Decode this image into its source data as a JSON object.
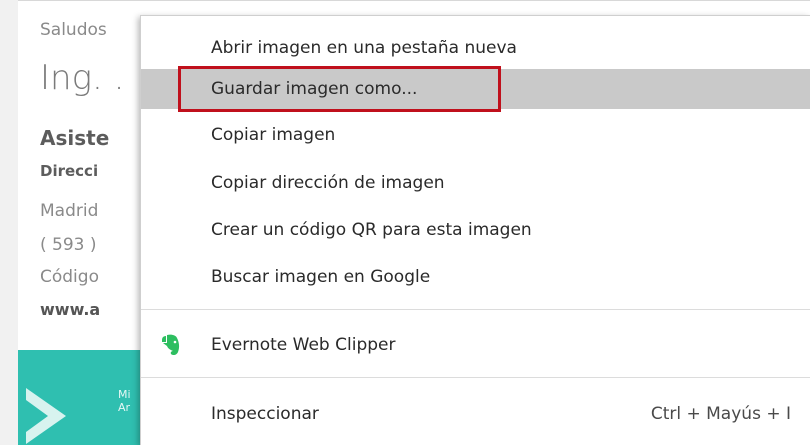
{
  "background_page": {
    "greeting": "Saludos",
    "name": "Ing. .",
    "role": "Asiste",
    "department": "Direcci",
    "city": "Madrid",
    "phone": "( 593 )",
    "code": "Código",
    "website": "www.a",
    "banner_text_line1": "Mi",
    "banner_text_line2": "Ar"
  },
  "context_menu": {
    "items": [
      {
        "label": "Abrir imagen en una pestaña nueva"
      },
      {
        "label": "Guardar imagen como..."
      },
      {
        "label": "Copiar imagen"
      },
      {
        "label": "Copiar dirección de imagen"
      },
      {
        "label": "Crear un código QR para esta imagen"
      },
      {
        "label": "Buscar imagen en Google"
      },
      {
        "label": "Evernote Web Clipper",
        "icon": "evernote-icon"
      },
      {
        "label": "Inspeccionar",
        "shortcut": "Ctrl + Mayús + I"
      }
    ],
    "highlighted_item": "Guardar imagen como...",
    "annotation_color": "#c0101c"
  },
  "colors": {
    "highlight": "#c9c9c9",
    "banner": "#2fbfb0",
    "evernote": "#2dbe60"
  }
}
